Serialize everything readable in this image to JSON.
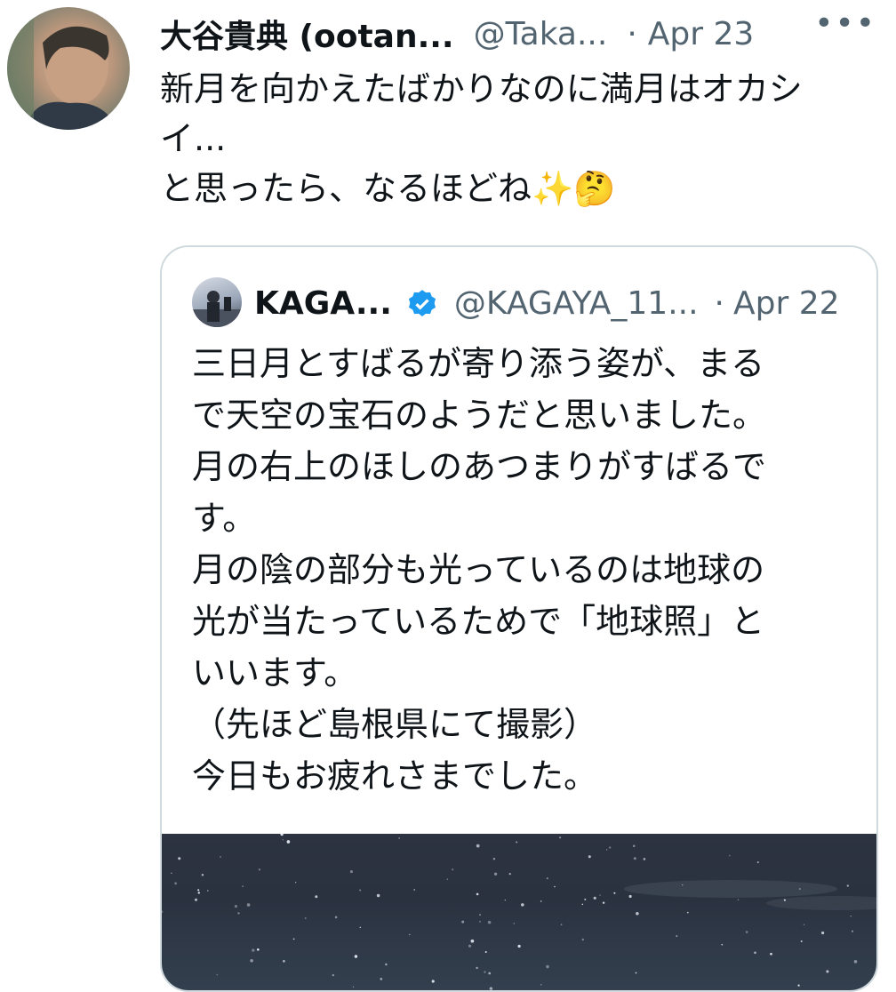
{
  "tweet": {
    "author_name": "大谷貴典 (ootan...",
    "author_handle": "@Taka...",
    "separator": "·",
    "date": "Apr 23",
    "more_icon": "more-horizontal-icon",
    "lines": [
      "新月を向かえたばかりなのに満月はオカシ",
      "イ...",
      "と思ったら、なるほどね✨🤔"
    ]
  },
  "quoted_tweet": {
    "author_name": "KAGA...",
    "verified_icon": "verified-badge-icon",
    "verified_color": "#1d9bf0",
    "author_handle": "@KAGAYA_11...",
    "separator": "·",
    "date": "Apr 22",
    "lines": [
      "三日月とすばるが寄り添う姿が、まる",
      "で天空の宝石のようだと思いました。",
      "月の右上のほしのあつまりがすばるで",
      "す。",
      "月の陰の部分も光っているのは地球の",
      "光が当たっているためで「地球照」と",
      "いいます。",
      "（先ほど島根県にて撮影）",
      "今日もお疲れさまでした。"
    ],
    "media": "night-sky-photo"
  },
  "colors": {
    "text_primary": "#0f1419",
    "text_secondary": "#536471",
    "border": "#cfd9de"
  }
}
